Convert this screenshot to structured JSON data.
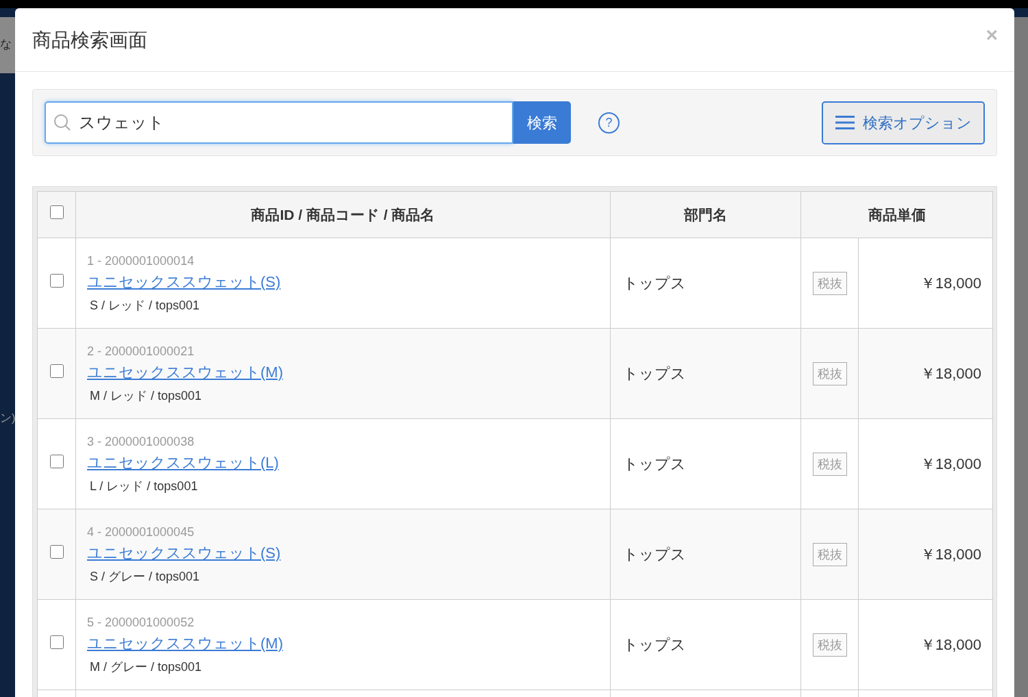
{
  "background": {
    "texts": [
      "な",
      "ン)"
    ]
  },
  "modal": {
    "title": "商品検索画面",
    "close": "×"
  },
  "search": {
    "value": "スウェット",
    "button": "検索",
    "help": "?",
    "options_button": "検索オプション"
  },
  "table": {
    "select_all": {
      "checked": false
    },
    "columns": [
      "商品ID / 商品コード / 商品名",
      "部門名",
      "商品単価"
    ],
    "rows": [
      {
        "checked": false,
        "id": "1 - 2000001000014",
        "name": "ユニセックススウェット(S)",
        "variant": "S / レッド / tops001",
        "department": "トップス",
        "tax": "税抜",
        "price": "￥18,000"
      },
      {
        "checked": false,
        "id": "2 - 2000001000021",
        "name": "ユニセックススウェット(M)",
        "variant": "M / レッド / tops001",
        "department": "トップス",
        "tax": "税抜",
        "price": "￥18,000"
      },
      {
        "checked": false,
        "id": "3 - 2000001000038",
        "name": "ユニセックススウェット(L)",
        "variant": "L / レッド / tops001",
        "department": "トップス",
        "tax": "税抜",
        "price": "￥18,000"
      },
      {
        "checked": false,
        "id": "4 - 2000001000045",
        "name": "ユニセックススウェット(S)",
        "variant": "S / グレー / tops001",
        "department": "トップス",
        "tax": "税抜",
        "price": "￥18,000"
      },
      {
        "checked": false,
        "id": "5 - 2000001000052",
        "name": "ユニセックススウェット(M)",
        "variant": "M / グレー / tops001",
        "department": "トップス",
        "tax": "税抜",
        "price": "￥18,000"
      }
    ]
  }
}
